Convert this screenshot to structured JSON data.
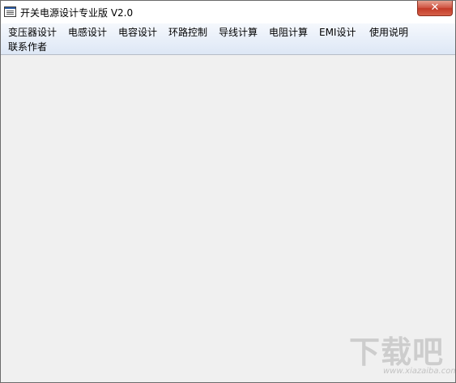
{
  "window": {
    "title": "开关电源设计专业版  V2.0",
    "close_label": "✕"
  },
  "menu": {
    "items": [
      "变压器设计",
      "电感设计",
      "电容设计",
      "环路控制",
      "导线计算",
      "电阻计算",
      "EMI设计",
      "使用说明",
      "联系作者"
    ]
  },
  "watermark": {
    "logo_text": "下载吧",
    "url": "www.xiazaiba.com"
  }
}
